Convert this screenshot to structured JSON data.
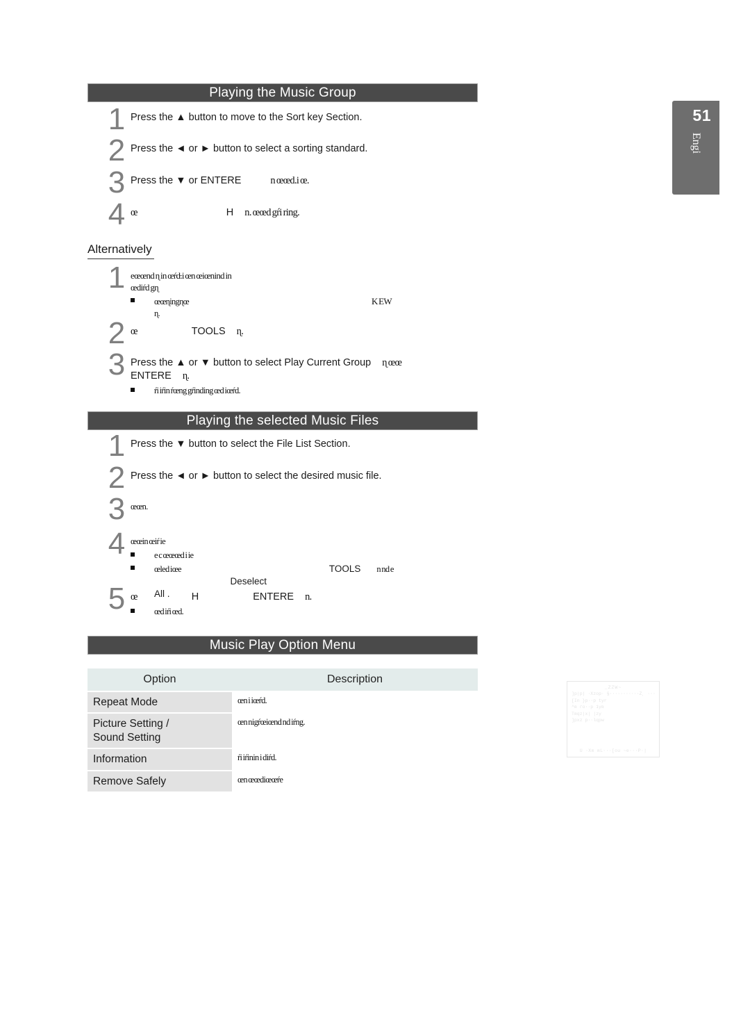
{
  "page": {
    "number": "51",
    "language_tab": "Engi"
  },
  "sections": [
    {
      "id": "playing-music-group",
      "title": "Playing the Music Group",
      "steps": [
        {
          "num": "1",
          "lines": [
            "Press the ▲ button to move to the Sort key Section."
          ],
          "bullets": []
        },
        {
          "num": "2",
          "lines": [
            "Press the ◄ or ► button to select a sorting standard."
          ],
          "bullets": []
        },
        {
          "num": "3",
          "lines": [
            "Press the ▼ or ENTERE"
          ],
          "smudge_tail": "n  œœd.i œ.",
          "bullets": []
        },
        {
          "num": "4",
          "smudge_lead": "œ",
          "mid_letter": "H",
          "smudge_tail": "n. œœd gŕi ring.",
          "lines": [],
          "bullets": []
        }
      ]
    },
    {
      "id": "playing-selected-music-files",
      "title": "Playing the selected Music Files",
      "steps": [
        {
          "num": "1",
          "lines": [
            "Press the ▼ button to select the File List Section."
          ],
          "bullets": []
        },
        {
          "num": "2",
          "lines": [
            "Press the ◄ or ► button to select the desired music file."
          ],
          "bullets": []
        },
        {
          "num": "3",
          "smudge_tail": "œœn.",
          "lines": [],
          "bullets": []
        },
        {
          "num": "4",
          "smudge_tail": "œœin œiŕ ie",
          "lines": [],
          "bullets": [
            "e    c    œœœd i ie",
            "œled iœe"
          ],
          "bullet2_tokens": [
            "TOOLS",
            "n nd e",
            "Deselect"
          ],
          "bullet2_cont": "All ."
        },
        {
          "num": "5",
          "smudge_lead": "œ",
          "mid_letter": "H",
          "token": "ENTERE",
          "smudge_tail": "n.",
          "lines": [],
          "bullets": [
            "œd iŕi œd."
          ]
        }
      ]
    }
  ],
  "alternatively": {
    "heading": "Alternatively",
    "steps": [
      {
        "num": "1",
        "smudge_line1": "eœœnd ɳ in œŕd̵.i œn œiœnind in",
        "smudge_line2": "œdiŕd gɳ",
        "bullet_left": "œœɳingɳœ",
        "bullet_right": "K   EW",
        "bullet_cont": "ɳ."
      },
      {
        "num": "2",
        "smudge_lead": "œ",
        "token": "TOOLS",
        "smudge_tail": "ɳ."
      },
      {
        "num": "3",
        "line1_a": "Press the ▲ or ▼ button to select Play Current Group",
        "line1_tail": "ɳ œœ",
        "line2_token": "ENTERE",
        "line2_tail": "ɳ.",
        "bullet": "ŕi iŕin ŕœng gŕinding œd iœŕd."
      }
    ]
  },
  "option_menu": {
    "title": "Music Play Option Menu",
    "headers": [
      "Option",
      "Description"
    ],
    "rows": [
      {
        "option": "Repeat Mode",
        "description": "œn  i iœŕd."
      },
      {
        "option": "Picture Setting /\nSound Setting",
        "description": "œn nigŕœiœnd nd iŕng."
      },
      {
        "option": "Information",
        "description": "ŕi iŕinin i diŕd."
      },
      {
        "option": "Remove Safely",
        "description": "œn œœdiœœŕe"
      }
    ]
  },
  "ghost_osd": {
    "title": "_ZZW~",
    "rows": [
      "]p|p| ·Xzop·   §···········Z¸ ···",
      "[In  }p··p  tyr",
      "^ʀ гo··p  1yʀ",
      "Tʀqz|x| |zy",
      "]pxz p··lqpw"
    ],
    "footer": "U ·Xʀ ʀL···[ou ~e···P·|"
  },
  "colors": {
    "bar": "#4a4a4a",
    "tab": "#6e6e6e",
    "table_header": "#e3eceb",
    "table_option_cell": "#e2e2e2",
    "step_number": "#7f7f7f"
  }
}
